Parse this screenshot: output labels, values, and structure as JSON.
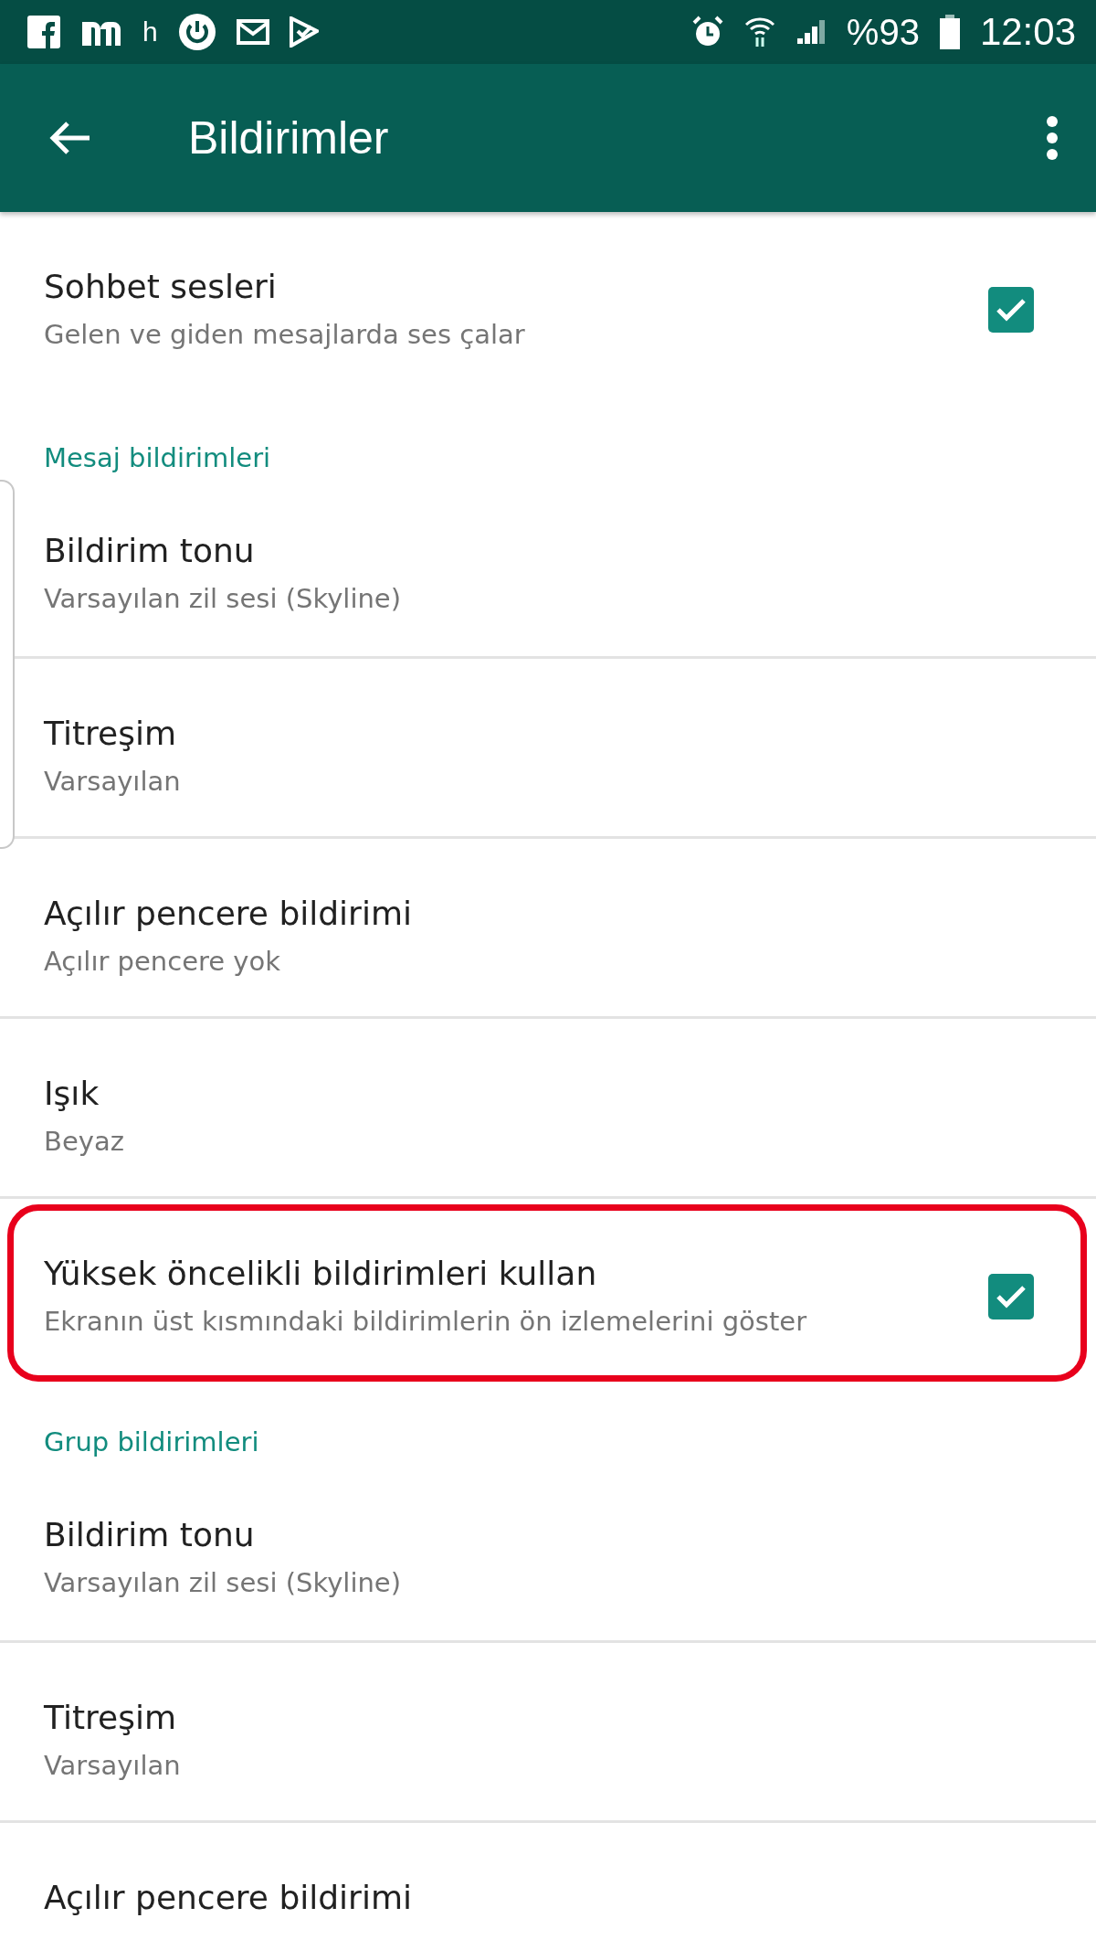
{
  "status_bar": {
    "app_letter": "h",
    "battery": "%93",
    "time": "12:03"
  },
  "app_bar": {
    "title": "Bildirimler"
  },
  "items": [
    {
      "kind": "setting",
      "title": "Sohbet sesleri",
      "subtitle": "Gelen ve giden mesajlarda ses çalar",
      "checked": true,
      "highlighted": false
    },
    {
      "kind": "section",
      "title": "Mesaj bildirimleri"
    },
    {
      "kind": "setting",
      "title": "Bildirim tonu",
      "subtitle": "Varsayılan zil sesi (Skyline)",
      "highlighted": false
    },
    {
      "kind": "setting",
      "title": "Titreşim",
      "subtitle": "Varsayılan",
      "highlighted": false
    },
    {
      "kind": "setting",
      "title": "Açılır pencere bildirimi",
      "subtitle": "Açılır pencere yok",
      "highlighted": false
    },
    {
      "kind": "setting",
      "title": "Işık",
      "subtitle": "Beyaz",
      "highlighted": false
    },
    {
      "kind": "setting",
      "title": "Yüksek öncelikli bildirimleri kullan",
      "subtitle": "Ekranın üst kısmındaki bildirimlerin ön izlemelerini göster",
      "checked": true,
      "highlighted": true
    },
    {
      "kind": "section",
      "title": "Grup bildirimleri"
    },
    {
      "kind": "setting",
      "title": "Bildirim tonu",
      "subtitle": "Varsayılan zil sesi (Skyline)",
      "highlighted": false
    },
    {
      "kind": "setting",
      "title": "Titreşim",
      "subtitle": "Varsayılan",
      "highlighted": false
    },
    {
      "kind": "setting",
      "title": "Açılır pencere bildirimi",
      "highlighted": false
    }
  ]
}
